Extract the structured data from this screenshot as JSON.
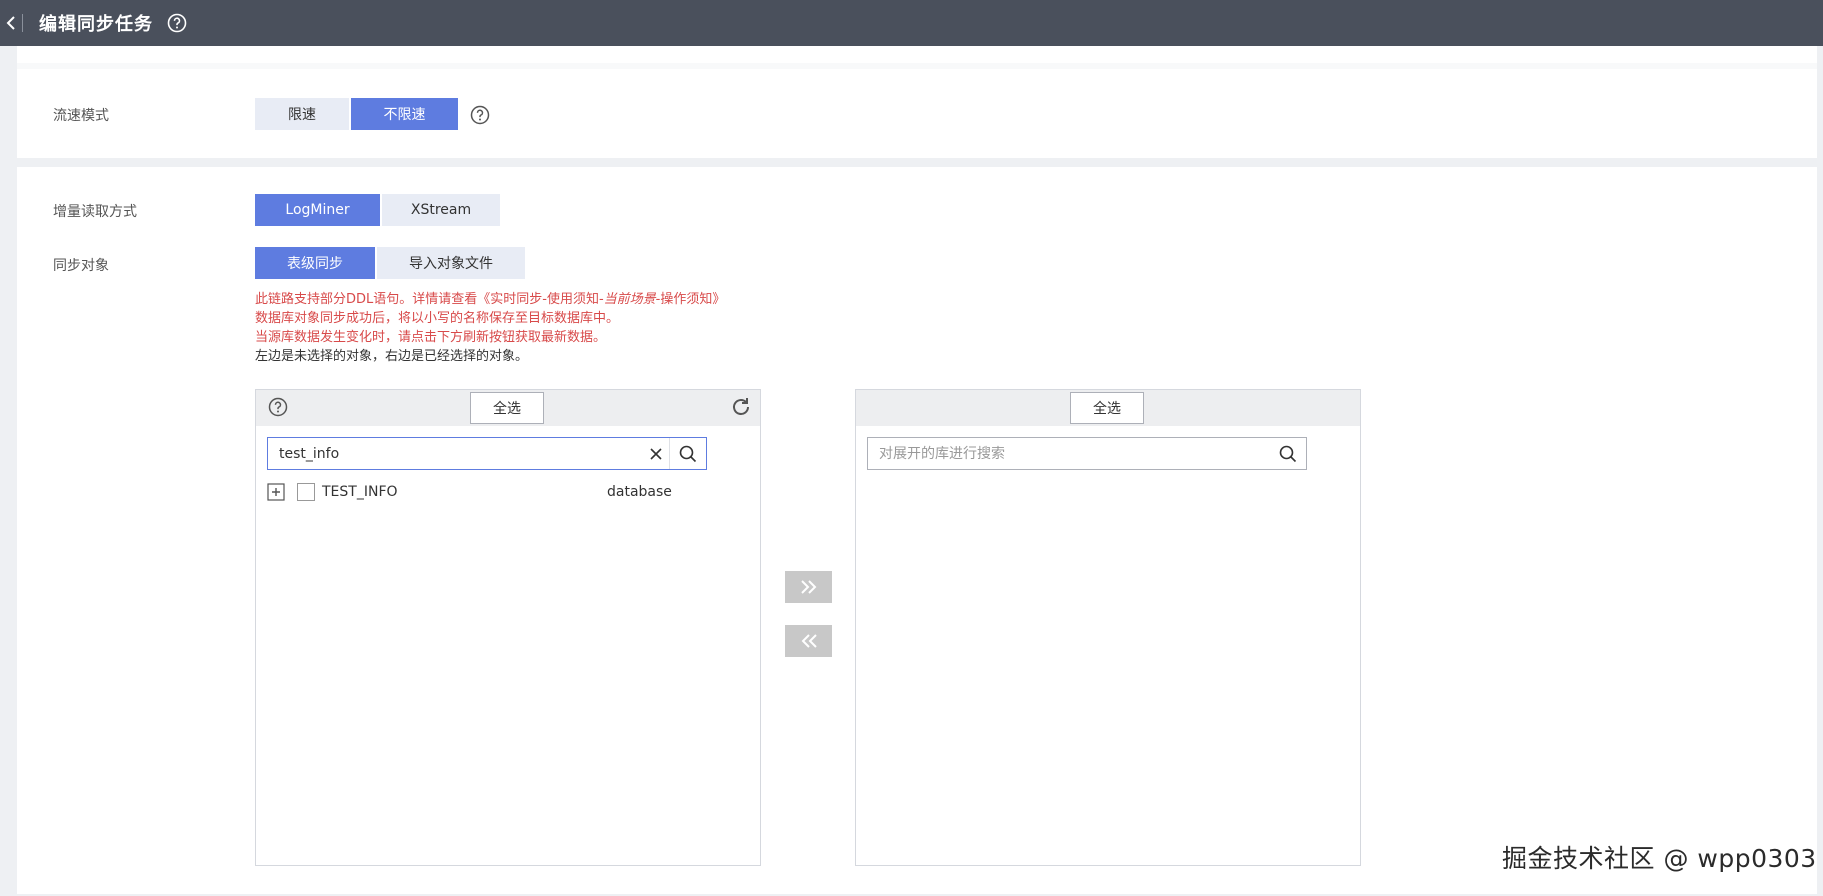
{
  "header": {
    "title": "编辑同步任务"
  },
  "flow_mode": {
    "label": "流速模式",
    "options": [
      "限速",
      "不限速"
    ],
    "selected": "不限速"
  },
  "incremental_read": {
    "label": "增量读取方式",
    "options": [
      "LogMiner",
      "XStream"
    ],
    "selected": "LogMiner"
  },
  "sync_object": {
    "label": "同步对象",
    "options": [
      "表级同步",
      "导入对象文件"
    ],
    "selected": "表级同步"
  },
  "notice": {
    "line1_prefix": "此链路支持部分DDL语句。详情请查看《实时同步-使用须知-",
    "line1_italic": "当前场景",
    "line1_suffix": "-操作须知》",
    "line2": "数据库对象同步成功后，将以小写的名称保存至目标数据库中。",
    "line3": "当源库数据发生变化时，请点击下方刷新按钮获取最新数据。",
    "line4": "左边是未选择的对象，右边是已经选择的对象。"
  },
  "left_panel": {
    "select_all_label": "全选",
    "search_value": "test_info",
    "tree": [
      {
        "name": "TEST_INFO",
        "type": "database",
        "checked": false
      }
    ]
  },
  "right_panel": {
    "select_all_label": "全选",
    "search_placeholder": "对展开的库进行搜索"
  },
  "watermark": "掘金技术社区 @ wpp0303",
  "colors": {
    "topbar": "#4a505c",
    "primary": "#5e7ce0",
    "segment_off": "#e8ecf5",
    "notice_red": "#d84a4a"
  }
}
